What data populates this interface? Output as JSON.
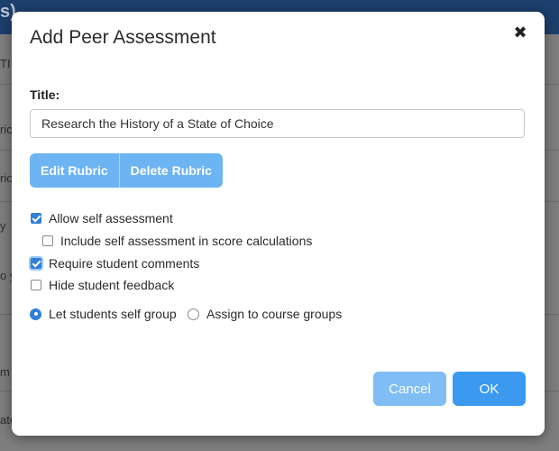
{
  "background": {
    "header_text": "s)",
    "row_fragments": [
      "TI",
      "ric",
      "ric",
      "y",
      "o y",
      "m",
      "ate"
    ]
  },
  "dialog": {
    "title": "Add Peer Assessment",
    "close_symbol": "✖",
    "title_label": "Title:",
    "title_value": "Research the History of a State of Choice",
    "edit_rubric": "Edit Rubric",
    "delete_rubric": "Delete Rubric",
    "options": {
      "allow_self_assessment": {
        "label": "Allow self assessment",
        "checked": true
      },
      "include_self_assessment": {
        "label": "Include self assessment in score calculations",
        "checked": false
      },
      "require_comments": {
        "label": "Require student comments",
        "checked": true
      },
      "hide_feedback": {
        "label": "Hide student feedback",
        "checked": false
      }
    },
    "grouping": {
      "self_group": {
        "label": "Let students self group",
        "selected": true
      },
      "course_groups": {
        "label": "Assign to course groups",
        "selected": false
      }
    },
    "cancel": "Cancel",
    "ok": "OK"
  },
  "colors": {
    "primary": "#3b9af0",
    "primary_light": "#6db4f3",
    "checkbox_checked": "#2f80d6",
    "header_dark": "#1d3f6e"
  }
}
